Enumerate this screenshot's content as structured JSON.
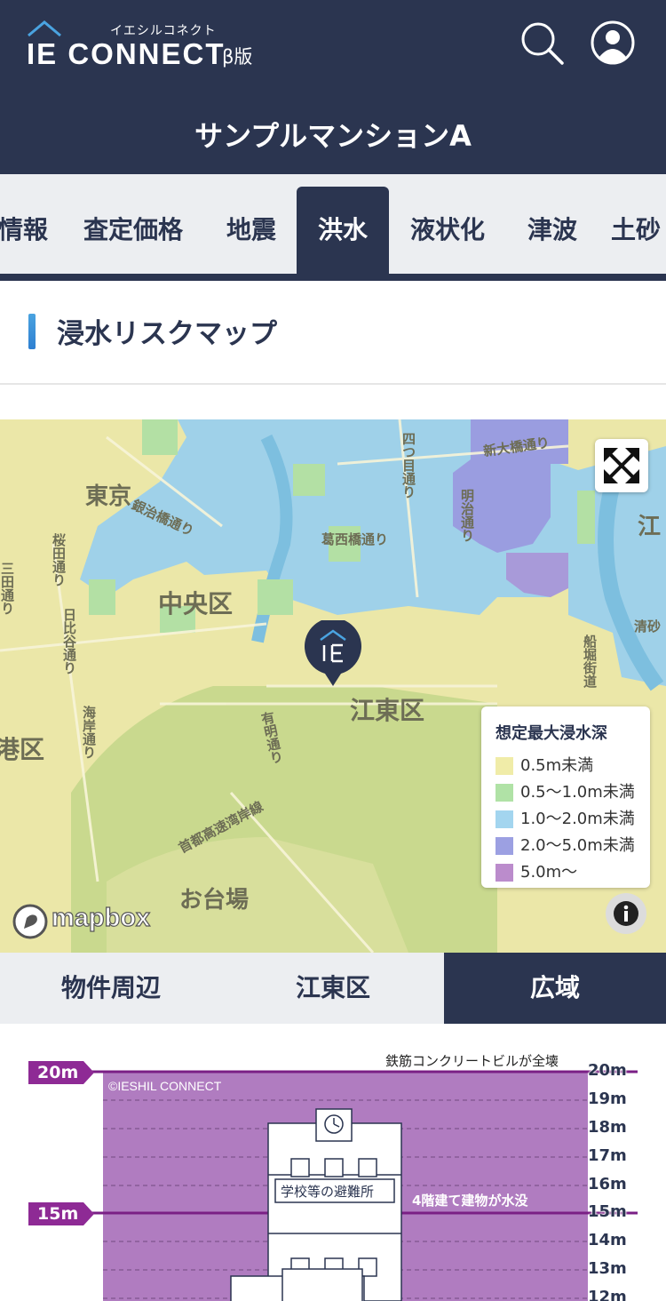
{
  "header": {
    "logo_kana": "イエシルコネクト",
    "logo_text": "IE CONNECT",
    "beta_label": "β版",
    "title": "サンプルマンションA",
    "search_icon": "search-icon",
    "account_icon": "user-icon"
  },
  "tabs": [
    {
      "label": "情報"
    },
    {
      "label": "査定価格"
    },
    {
      "label": "地震"
    },
    {
      "label": "洪水"
    },
    {
      "label": "液状化"
    },
    {
      "label": "津波"
    },
    {
      "label": "土砂"
    }
  ],
  "active_tab": "洪水",
  "section": {
    "title": "浸水リスクマップ"
  },
  "map": {
    "labels": {
      "tokyo": "東京",
      "chuo": "中央区",
      "koto": "江東区",
      "minato": "港区",
      "odaiba": "お台場",
      "ginza": "銀治橋通り",
      "kazusa": "葛西橋通り",
      "yotsume": "四つ目通り",
      "meiji": "明治通り",
      "shin_ohashi": "新大橋通り",
      "sakurada": "桜田通り",
      "hibiya": "日比谷通り",
      "kaigan": "海岸通り",
      "ariake": "有明通り",
      "shuto": "首都高速湾岸線",
      "funabori": "船堀街道",
      "kiyosumi": "清砂",
      "e": "江",
      "mita": "三田通り"
    },
    "expand_icon": "expand-arrows-icon",
    "marker_label": "IE",
    "attribution": "mapbox",
    "info_icon": "info-icon",
    "legend": {
      "title": "想定最大浸水深",
      "items": [
        {
          "label": "0.5m未満",
          "color": "#f0eca8"
        },
        {
          "label": "0.5〜1.0m未満",
          "color": "#b0e2a6"
        },
        {
          "label": "1.0〜2.0m未満",
          "color": "#a3d5ef"
        },
        {
          "label": "2.0〜5.0m未満",
          "color": "#9ca0e2"
        },
        {
          "label": "5.0m〜",
          "color": "#bb8ccc"
        }
      ]
    }
  },
  "scope_tabs": [
    {
      "label": "物件周辺"
    },
    {
      "label": "江東区"
    },
    {
      "label": "広域"
    }
  ],
  "active_scope": "広域",
  "depth_chart": {
    "copyright": "©IESHIL CONNECT",
    "markers": [
      {
        "label": "20m",
        "note": "鉄筋コンクリートビルが全壊"
      },
      {
        "label": "15m",
        "note": "4階建て建物が水没"
      }
    ],
    "building_label": "学校等の避難所",
    "ticks": [
      "20m",
      "19m",
      "18m",
      "17m",
      "16m",
      "15m",
      "14m",
      "13m",
      "12m"
    ],
    "fill_color": "#b07cc0",
    "marker_color": "#8e2a95"
  }
}
